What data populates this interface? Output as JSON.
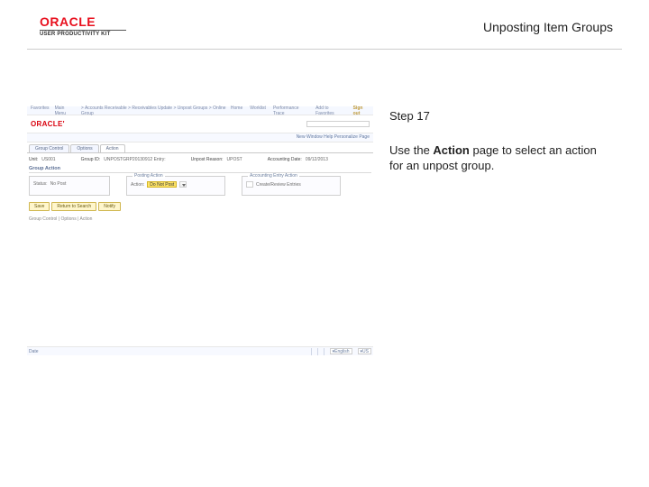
{
  "header": {
    "logo_brand": "ORACLE",
    "logo_sub": "USER PRODUCTIVITY KIT",
    "title": "Unposting Item Groups"
  },
  "instruction": {
    "step_label": "Step 17",
    "body_pre": "Use the ",
    "body_bold": "Action",
    "body_post": " page to select an action for an unpost group."
  },
  "shot": {
    "topnav": {
      "left1": "Favorites",
      "left2": "Main Menu",
      "crumb": "> Accounts Receivable > Receivables Update > Unpost Groups > Online Group",
      "right_items": [
        "Home",
        "Worklist",
        "Performance Trace",
        "Add to Favorites"
      ],
      "signout": "Sign out"
    },
    "brand": "ORACLE'",
    "new_window": "New Window   Help   Personalize Page",
    "tabs": {
      "t1": "Group Control",
      "t2": "Options",
      "t3": "Action"
    },
    "info": {
      "unit_label": "Unit:",
      "unit_value": "US001",
      "group_label": "Group ID:",
      "group_value": "UNPOSTGRP20130912  Entry:",
      "unpost_label": "Unpost Reason:",
      "unpost_value": "UPOST",
      "acct_label": "Accounting Date:",
      "acct_value": "09/12/2013"
    },
    "group_action_hdr": "Group Action",
    "status_label1": "Status:",
    "status_label2": "No Post",
    "posting_title": "Posting Action",
    "action_label": "Action:",
    "action_value": "Do Not Post",
    "acct_entry_title": "Accounting Entry Action",
    "create_label": "Create/Review Entries",
    "buttons": {
      "b1": "Save",
      "b2": "Return to Search",
      "b3": "Notify"
    },
    "status_line": "Group Control | Options | Action",
    "footer": {
      "label": "Date",
      "sel1": "English",
      "sel2": "US"
    }
  }
}
